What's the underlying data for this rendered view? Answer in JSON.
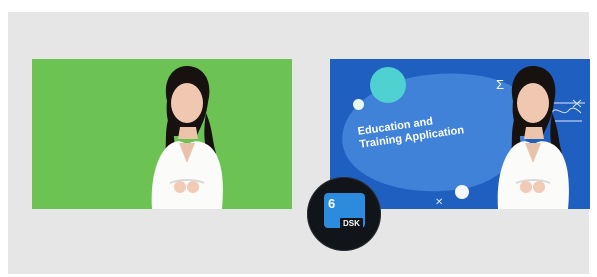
{
  "overlay": {
    "title_line1": "Education and",
    "title_line2": "Training Application"
  },
  "dsk_badge": {
    "number": "6",
    "label": "DSK"
  },
  "colors": {
    "background": "#e6e6e6",
    "green_screen": "#6cc354",
    "blue_background": "#1f5fbf",
    "accent": "#2d8bde"
  },
  "icons": {
    "sigma": "sigma-icon",
    "doodle": "formula-doodle-icon"
  }
}
